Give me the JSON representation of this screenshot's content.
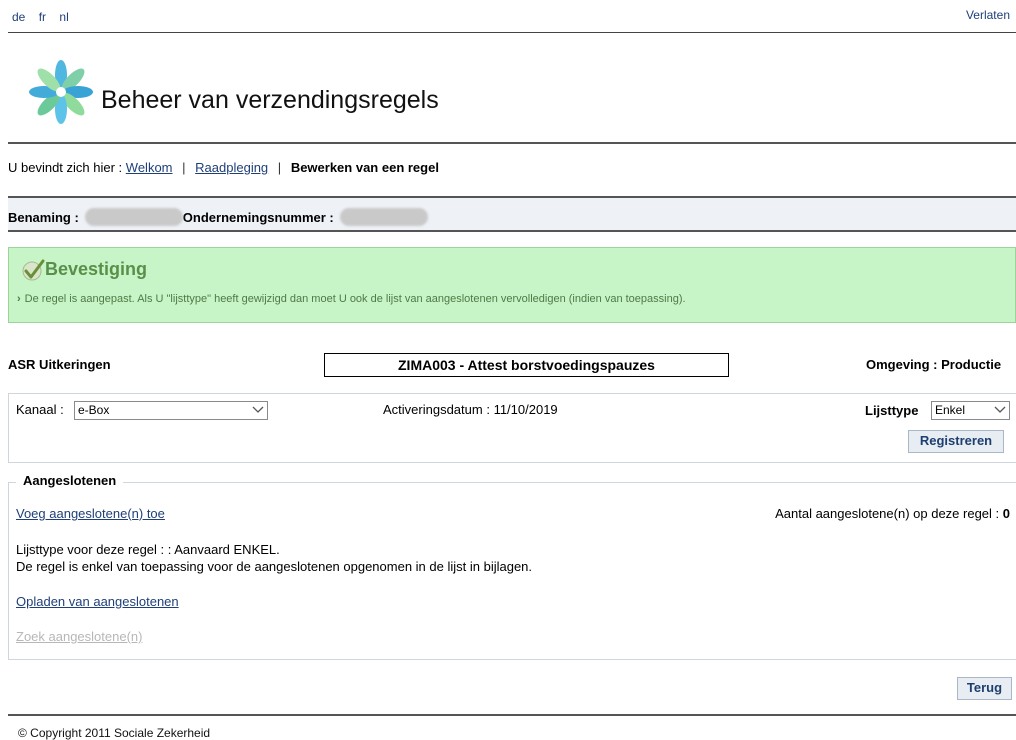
{
  "top": {
    "languages": [
      "de",
      "fr",
      "nl"
    ],
    "leave_label": "Verlaten"
  },
  "header": {
    "title": "Beheer van verzendingsregels"
  },
  "breadcrumb": {
    "prefix": "U bevindt zich hier :",
    "items": [
      "Welkom",
      "Raadpleging"
    ],
    "current": "Bewerken van een regel"
  },
  "identity": {
    "name_label": "Benaming :",
    "company_label": "Ondernemingsnummer :"
  },
  "confirmation": {
    "title": "Bevestiging",
    "message": "De regel is aangepast. Als U \"lijsttype\" heeft gewijzigd dan moet U ook de lijst van aangeslotenen vervolledigen (indien van toepassing)."
  },
  "rule": {
    "service": "ASR Uitkeringen",
    "code_title": "ZIMA003 - Attest borstvoedingspauzes",
    "environment": "Omgeving : Productie"
  },
  "settings": {
    "channel_label": "Kanaal :",
    "channel_value": "e-Box",
    "activation_label": "Activeringsdatum :",
    "activation_date": "11/10/2019",
    "list_type_label": "Lijsttype",
    "list_type_value": "Enkel",
    "register_button": "Registreren"
  },
  "affiliates": {
    "legend": "Aangeslotenen",
    "add_link": "Voeg aangeslotene(n) toe",
    "count_label": "Aantal aangeslotene(n) op deze regel :",
    "count_value": "0",
    "list_type_note": "Lijsttype voor deze regel : : Aanvaard ENKEL.",
    "rule_note": "De regel is enkel van toepassing voor de aangeslotenen opgenomen in de lijst in bijlagen.",
    "upload_link": "Opladen van aangeslotenen",
    "search_link": "Zoek aangeslotene(n)"
  },
  "actions": {
    "back_button": "Terug"
  },
  "footer": {
    "copyright": "© Copyright 2011 Sociale Zekerheid"
  },
  "colors": {
    "link": "#1f3f7a",
    "confirm_bg": "#c8f5c8",
    "confirm_text": "#5a8f4a",
    "button_bg": "#e8edf3"
  }
}
